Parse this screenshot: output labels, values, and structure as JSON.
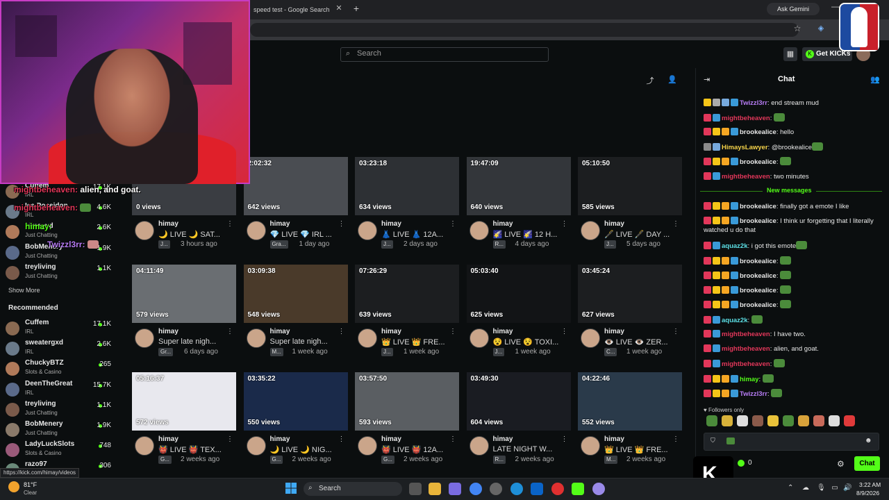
{
  "browser": {
    "active_tab_title": "speed test - Google Search",
    "tab_close": "✕",
    "new_tab": "+",
    "ask_gemini": "Ask Gemini"
  },
  "header": {
    "search_placeholder": "Search",
    "get_kicks": "Get KICKs"
  },
  "sidebar": {
    "following": [
      {
        "name": "Cuffem",
        "category": "IRL",
        "viewers": "17.1K"
      },
      {
        "name": "Ice Poseidon",
        "category": "IRL",
        "viewers": "4.6K"
      },
      {
        "name": "himayxd",
        "category": "Just Chatting",
        "viewers": "2.6K"
      },
      {
        "name": "BobMenery",
        "category": "Just Chatting",
        "viewers": "1.9K"
      },
      {
        "name": "treyliving",
        "category": "Just Chatting",
        "viewers": "1.1K"
      }
    ],
    "show_more": "Show More",
    "recommended_title": "Recommended",
    "recommended": [
      {
        "name": "Cuffem",
        "category": "IRL",
        "viewers": "17.1K"
      },
      {
        "name": "sweatergxd",
        "category": "IRL",
        "viewers": "2.6K"
      },
      {
        "name": "ChuckyBTZ",
        "category": "Slots & Casino",
        "viewers": "265"
      },
      {
        "name": "DeenTheGreat",
        "category": "IRL",
        "viewers": "15.7K"
      },
      {
        "name": "treyliving",
        "category": "Just Chatting",
        "viewers": "1.1K"
      },
      {
        "name": "BobMenery",
        "category": "Just Chatting",
        "viewers": "1.9K"
      },
      {
        "name": "LadyLuckSlots",
        "category": "Slots & Casino",
        "viewers": "748"
      },
      {
        "name": "razo97",
        "category": "",
        "viewers": "306"
      }
    ]
  },
  "overlay_chat": [
    {
      "user": "mightbeheaven:",
      "text": "alien, and goat."
    },
    {
      "user": "mightbeheaven:",
      "text": ""
    },
    {
      "user": "himay:",
      "text": ""
    },
    {
      "user": "Twizzl3rr:",
      "text": ""
    }
  ],
  "videos": [
    {
      "duration": "",
      "views": "0 views",
      "channel": "himay",
      "title": "🌙 LIVE 🌙 SAT...",
      "tag": "J...",
      "ago": "3 hours ago"
    },
    {
      "duration": "2:02:32",
      "views": "642 views",
      "channel": "himay",
      "title": "💎 LIVE 💎 IRL ...",
      "tag": "Gra...",
      "ago": "1 day ago"
    },
    {
      "duration": "03:23:18",
      "views": "634 views",
      "channel": "himay",
      "title": "👗 LIVE 👗 12A...",
      "tag": "J...",
      "ago": "2 days ago"
    },
    {
      "duration": "19:47:09",
      "views": "640 views",
      "channel": "himay",
      "title": "🌠 LIVE 🌠 12 H...",
      "tag": "R...",
      "ago": "4 days ago"
    },
    {
      "duration": "05:10:50",
      "views": "585 views",
      "channel": "himay",
      "title": "🖋️ LIVE 🖋️ DAY ...",
      "tag": "J...",
      "ago": "5 days ago"
    },
    {
      "duration": "04:11:49",
      "views": "579 views",
      "channel": "himay",
      "title": "Super late nigh...",
      "tag": "Gr...",
      "ago": "6 days ago"
    },
    {
      "duration": "03:09:38",
      "views": "548 views",
      "channel": "himay",
      "title": "Super late nigh...",
      "tag": "M...",
      "ago": "1 week ago"
    },
    {
      "duration": "07:26:29",
      "views": "639 views",
      "channel": "himay",
      "title": "👑 LIVE 👑 FRE...",
      "tag": "J...",
      "ago": "1 week ago"
    },
    {
      "duration": "05:03:40",
      "views": "625 views",
      "channel": "himay",
      "title": "😵 LIVE 😵 TOXI...",
      "tag": "J...",
      "ago": "1 week ago"
    },
    {
      "duration": "03:45:24",
      "views": "627 views",
      "channel": "himay",
      "title": "👁️ LIVE 👁️ ZER...",
      "tag": "C...",
      "ago": "1 week ago"
    },
    {
      "duration": "05:16:37",
      "views": "572 views",
      "channel": "himay",
      "title": "👹 LIVE 👹 TEX...",
      "tag": "G...",
      "ago": "2 weeks ago"
    },
    {
      "duration": "03:35:22",
      "views": "550 views",
      "channel": "himay",
      "title": "🌙 LIVE 🌙 NIG...",
      "tag": "G...",
      "ago": "2 weeks ago"
    },
    {
      "duration": "03:57:50",
      "views": "593 views",
      "channel": "himay",
      "title": "👹 LIVE 👹 12A...",
      "tag": "G...",
      "ago": "2 weeks ago"
    },
    {
      "duration": "03:49:30",
      "views": "604 views",
      "channel": "himay",
      "title": "LATE NIGHT W...",
      "tag": "R...",
      "ago": "2 weeks ago"
    },
    {
      "duration": "04:22:46",
      "views": "552 views",
      "channel": "himay",
      "title": "👑 LIVE 👑 FRE...",
      "tag": "M...",
      "ago": "2 weeks ago"
    }
  ],
  "chat": {
    "title": "Chat",
    "new_messages": "New messages",
    "messages": [
      {
        "user": "Twizzl3rr",
        "color": "#b77cf5",
        "text": "end stream mud"
      },
      {
        "user": "mightbeheaven",
        "color": "#e2375a",
        "text": ""
      },
      {
        "user": "brookealice",
        "color": "#e8e8e8",
        "text": "hello"
      },
      {
        "user": "HimaysLawyer",
        "color": "#f5d34a",
        "text": "@brookealice"
      },
      {
        "user": "brookealice",
        "color": "#e8e8e8",
        "text": ""
      },
      {
        "user": "mightbeheaven",
        "color": "#e2375a",
        "text": "two minutes"
      },
      {
        "user": "brookealice",
        "color": "#e8e8e8",
        "text": "finally got a emote I like"
      },
      {
        "user": "brookealice",
        "color": "#e8e8e8",
        "text": "I think ur forgetting that I literally watched u do that"
      },
      {
        "user": "aquaz2k",
        "color": "#5ce0e6",
        "text": "i got this emote"
      },
      {
        "user": "brookealice",
        "color": "#e8e8e8",
        "text": ""
      },
      {
        "user": "brookealice",
        "color": "#e8e8e8",
        "text": ""
      },
      {
        "user": "brookealice",
        "color": "#e8e8e8",
        "text": ""
      },
      {
        "user": "brookealice",
        "color": "#e8e8e8",
        "text": ""
      },
      {
        "user": "aquaz2k",
        "color": "#5ce0e6",
        "text": ""
      },
      {
        "user": "mightbeheaven",
        "color": "#e2375a",
        "text": "I have two."
      },
      {
        "user": "mightbeheaven",
        "color": "#e2375a",
        "text": "alien, and goat."
      },
      {
        "user": "mightbeheaven",
        "color": "#e2375a",
        "text": ""
      },
      {
        "user": "himay",
        "color": "#53fc18",
        "text": ""
      },
      {
        "user": "Twizzl3rr",
        "color": "#b77cf5",
        "text": ""
      }
    ],
    "followers_only": "Followers only",
    "points": "0",
    "send_label": "Chat"
  },
  "status_url": "https://kick.com/himay/videos",
  "taskbar": {
    "weather_temp": "81°F",
    "weather_desc": "Clear",
    "search_label": "Search",
    "time": "3:22 AM",
    "date": "8/9/2026"
  },
  "colors": {
    "accent": "#53fc18",
    "background": "#0b0e0f"
  }
}
